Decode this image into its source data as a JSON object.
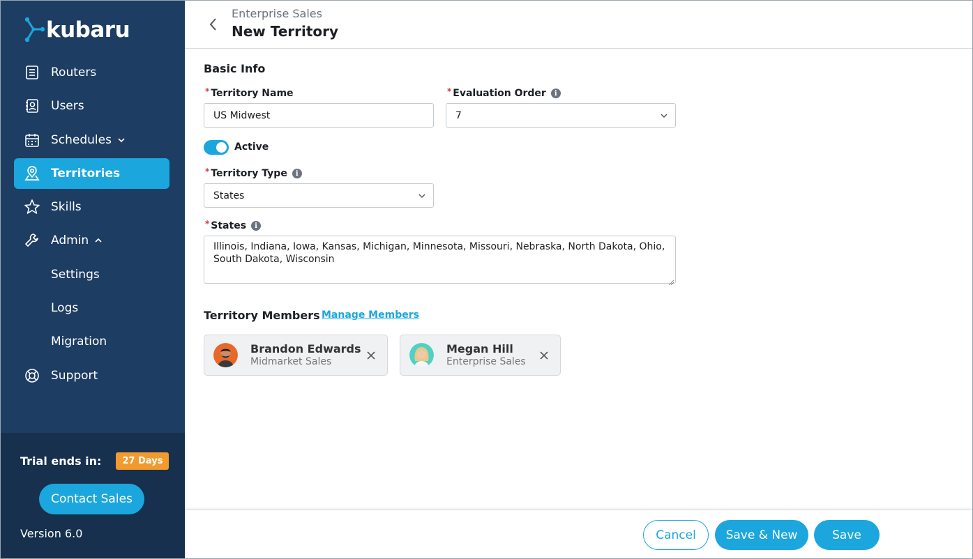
{
  "brand": {
    "name": "kubaru",
    "logo_icon": "kubaru-logo-icon"
  },
  "sidebar": {
    "items": [
      {
        "label": "Routers",
        "icon": "list-icon"
      },
      {
        "label": "Users",
        "icon": "contacts-icon"
      },
      {
        "label": "Schedules",
        "icon": "calendar-icon",
        "chevron": "down"
      },
      {
        "label": "Territories",
        "icon": "map-pin-icon",
        "active": true
      },
      {
        "label": "Skills",
        "icon": "star-icon"
      },
      {
        "label": "Admin",
        "icon": "wrench-icon",
        "chevron": "up"
      },
      {
        "label": "Settings",
        "sub": true
      },
      {
        "label": "Logs",
        "sub": true
      },
      {
        "label": "Migration",
        "sub": true
      },
      {
        "label": "Support",
        "icon": "lifebuoy-icon"
      }
    ],
    "trial_label": "Trial ends in:",
    "trial_badge": "27 Days",
    "contact_label": "Contact Sales",
    "version": "Version 6.0"
  },
  "header": {
    "breadcrumb": "Enterprise Sales",
    "title": "New Territory"
  },
  "form": {
    "section_title": "Basic Info",
    "territory_name": {
      "label": "Territory Name",
      "value": "US Midwest"
    },
    "evaluation_order": {
      "label": "Evaluation Order",
      "value": "7"
    },
    "active": {
      "label": "Active",
      "on": true
    },
    "territory_type": {
      "label": "Territory Type",
      "value": "States"
    },
    "states": {
      "label": "States",
      "value": "Illinois, Indiana, Iowa, Kansas, Michigan, Minnesota, Missouri, Nebraska, North Dakota, Ohio, South Dakota, Wisconsin"
    }
  },
  "members": {
    "title": "Territory Members",
    "manage_label": "Manage Members",
    "list": [
      {
        "name": "Brandon Edwards",
        "team": "Midmarket Sales"
      },
      {
        "name": "Megan Hill",
        "team": "Enterprise Sales"
      }
    ]
  },
  "footer": {
    "cancel": "Cancel",
    "save_new": "Save & New",
    "save": "Save"
  },
  "colors": {
    "sidebar": "#1d3d63",
    "accent": "#1ba7dd",
    "badge": "#f29a2e",
    "required": "#d9363e"
  }
}
